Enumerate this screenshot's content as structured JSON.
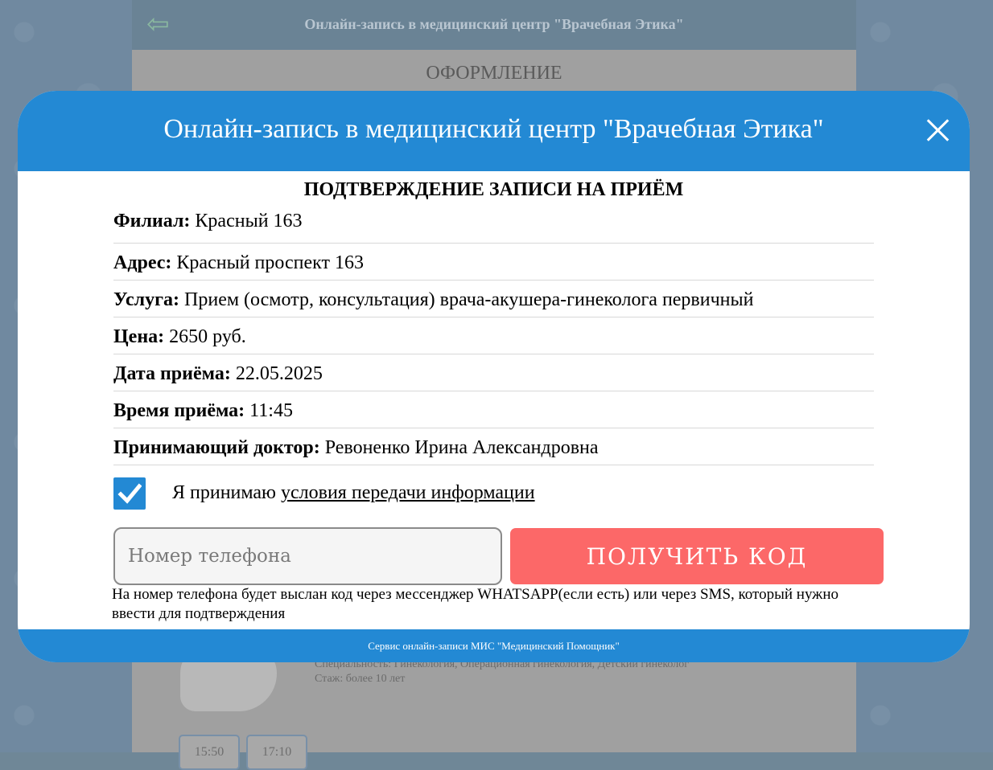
{
  "background": {
    "header_title": "Онлайн-запись в медицинский центр \"Врачебная Этика\"",
    "back_icon": "arrow-left-icon",
    "heading": "ОФОРМЛЕНИЕ",
    "specialty": "Специальность: Гинекология, Операционная гинекология, Детский гинеколог",
    "experience": "Стаж: более 10 лет",
    "slots": [
      "15:50",
      "17:10"
    ]
  },
  "modal": {
    "title": "Онлайн-запись в медицинский центр \"Врачебная Этика\"",
    "close_icon": "close-icon",
    "confirm_title": "ПОДТВЕРЖДЕНИЕ ЗАПИСИ НА ПРИЁМ",
    "rows": [
      {
        "label": "Филиал:",
        "value": "Красный 163"
      },
      {
        "label": "Адрес:",
        "value": "Красный проспект 163"
      },
      {
        "label": "Услуга:",
        "value": "Прием (осмотр, консультация) врача-акушера-гинеколога первичный"
      },
      {
        "label": "Цена:",
        "value": "2650 руб."
      },
      {
        "label": "Дата приёма:",
        "value": "22.05.2025"
      },
      {
        "label": "Время приёма:",
        "value": "11:45"
      },
      {
        "label": "Принимающий доктор:",
        "value": "Ревоненко Ирина Александровна"
      }
    ],
    "consent": {
      "checked": true,
      "text": "Я принимаю ",
      "link": "условия передачи информации"
    },
    "phone_placeholder": "Номер телефона",
    "phone_value": "",
    "get_code_label": "ПОЛУЧИТЬ КОД",
    "hint": "На номер телефона будет выслан код через мессенджер WHATSAPP(если есть) или через SMS, который нужно ввести для подтверждения",
    "footer": "Сервис онлайн-записи МИС \"Медицинский Помощник\""
  },
  "colors": {
    "primary": "#2389d4",
    "button": "#fc6868",
    "overlay": "#6f8797"
  }
}
